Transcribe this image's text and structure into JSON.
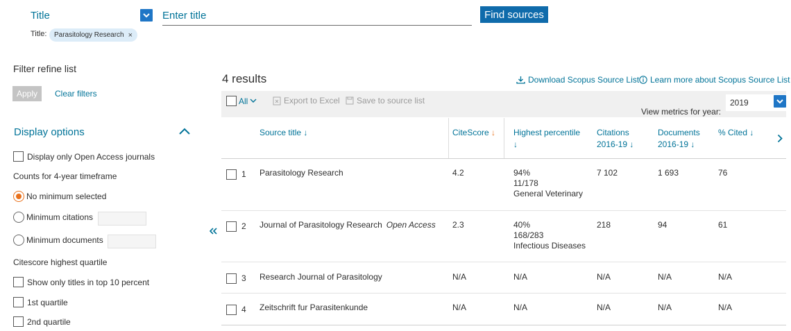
{
  "search": {
    "field_label": "Title",
    "placeholder": "Enter title",
    "find_label": "Find sources",
    "chip_prefix": "Title:",
    "chip_value": "Parasitology Research"
  },
  "sidebar": {
    "title": "Filter refine list",
    "apply_label": "Apply",
    "clear_label": "Clear filters",
    "display_options": "Display options",
    "open_access": "Display only Open Access journals",
    "counts_label": "Counts for 4-year timeframe",
    "no_min": "No minimum selected",
    "min_citations": "Minimum citations",
    "min_documents": "Minimum documents",
    "quartile_label": "Citescore highest quartile",
    "top10": "Show only titles in top 10 percent",
    "q1": "1st quartile",
    "q2": "2nd quartile"
  },
  "results": {
    "count": "4 results",
    "download_link": "Download Scopus Source List",
    "learn_link": "Learn more about Scopus Source List",
    "all_label": "All",
    "export_label": "Export to Excel",
    "save_label": "Save to source list",
    "metrics_label": "View metrics for year:",
    "year": "2019"
  },
  "table": {
    "headers": {
      "source_title": "Source title",
      "citescore": "CiteScore",
      "percentile": "Highest percentile",
      "citations_1": "Citations",
      "citations_2": "2016-19",
      "documents_1": "Documents",
      "documents_2": "2016-19",
      "cited": "% Cited"
    },
    "rows": [
      {
        "num": "1",
        "title": "Parasitology Research",
        "oa": "",
        "citescore": "4.2",
        "pct": "94%",
        "rank": "11/178",
        "category": "General Veterinary",
        "citations": "7 102",
        "documents": "1 693",
        "cited": "76"
      },
      {
        "num": "2",
        "title": "Journal of Parasitology Research",
        "oa": "Open Access",
        "citescore": "2.3",
        "pct": "40%",
        "rank": "168/283",
        "category": "Infectious Diseases",
        "citations": "218",
        "documents": "94",
        "cited": "61"
      },
      {
        "num": "3",
        "title": "Research Journal of Parasitology",
        "oa": "",
        "citescore": "N/A",
        "pct": "N/A",
        "rank": "",
        "category": "",
        "citations": "N/A",
        "documents": "N/A",
        "cited": "N/A"
      },
      {
        "num": "4",
        "title": "Zeitschrift fur Parasitenkunde",
        "oa": "",
        "citescore": "N/A",
        "pct": "N/A",
        "rank": "",
        "category": "",
        "citations": "N/A",
        "documents": "N/A",
        "cited": "N/A"
      }
    ]
  },
  "colors": {
    "link": "#007398",
    "primary_button": "#0f6bab",
    "accent_orange": "#e9711c"
  }
}
